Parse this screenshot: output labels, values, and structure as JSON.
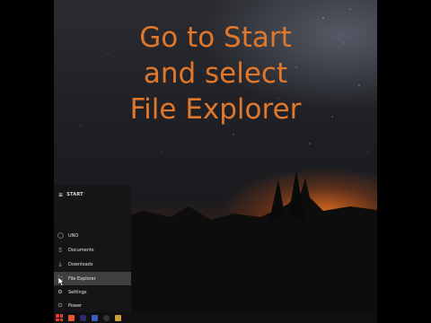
{
  "headline": {
    "line1": "Go to Start",
    "line2": "and select",
    "line3": "File Explorer"
  },
  "colors": {
    "headline": "#e0782c",
    "sunset": "#e66e1e",
    "menu_bg": "#161618",
    "windows_logo": "#e23a2a"
  },
  "start_menu": {
    "title": "START",
    "items": [
      {
        "icon": "user-circle-icon",
        "label": "UNO"
      },
      {
        "icon": "document-icon",
        "label": "Documents"
      },
      {
        "icon": "download-icon",
        "label": "Downloads"
      },
      {
        "icon": "folder-icon",
        "label": "File Explorer",
        "highlighted": true
      },
      {
        "icon": "gear-icon",
        "label": "Settings"
      },
      {
        "icon": "power-icon",
        "label": "Power"
      }
    ]
  },
  "taskbar": {
    "icons": [
      "windows-logo-icon",
      "browser-icon",
      "terminal-icon",
      "app-icon",
      "record-icon",
      "folder-icon"
    ]
  }
}
